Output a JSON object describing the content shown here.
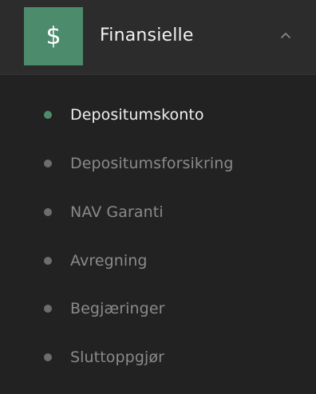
{
  "section": {
    "icon_glyph": "$",
    "icon_name": "dollar-icon",
    "title": "Finansielle",
    "expanded": true,
    "accent_color": "#4c8c6c"
  },
  "menu": {
    "items": [
      {
        "label": "Depositumskonto",
        "active": true
      },
      {
        "label": "Depositumsforsikring",
        "active": false
      },
      {
        "label": "NAV Garanti",
        "active": false
      },
      {
        "label": "Avregning",
        "active": false
      },
      {
        "label": "Begjæringer",
        "active": false
      },
      {
        "label": "Sluttoppgjør",
        "active": false
      }
    ]
  }
}
